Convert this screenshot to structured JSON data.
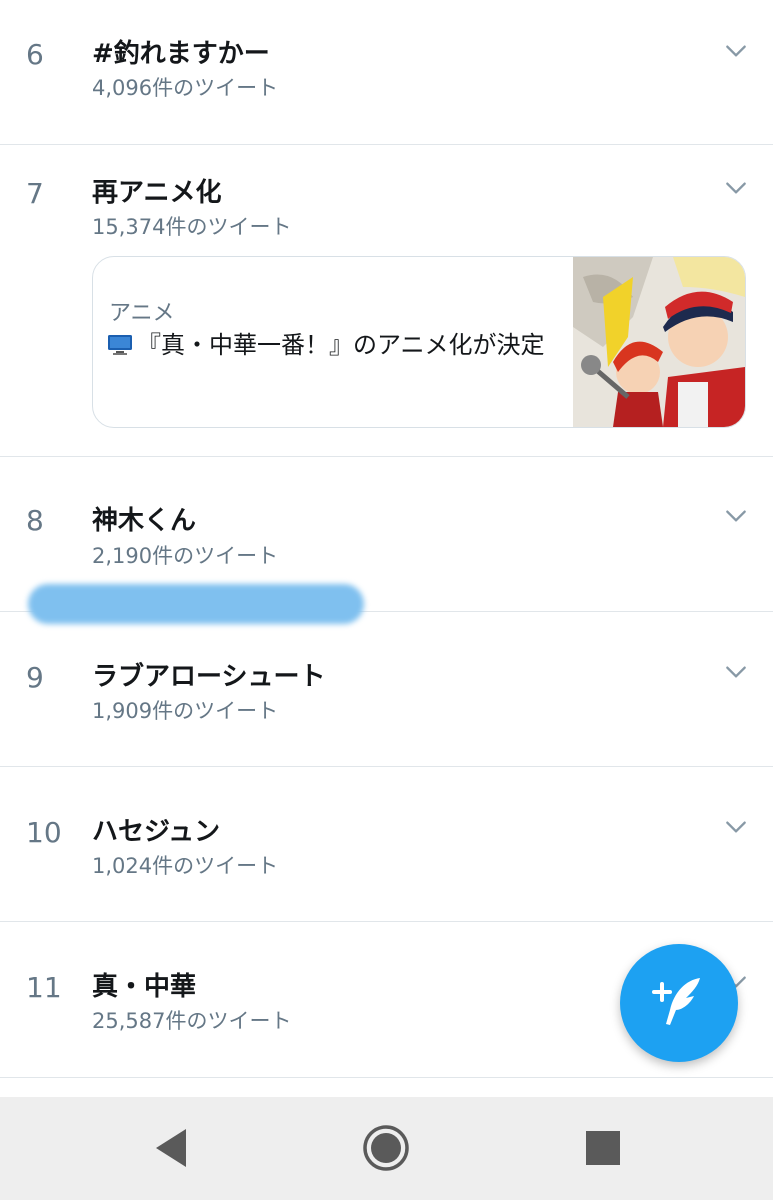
{
  "trends": [
    {
      "rank": "6",
      "title": "#釣れますかー",
      "count": "4,096件のツイート"
    },
    {
      "rank": "7",
      "title": "再アニメ化",
      "count": "15,374件のツイート",
      "card": {
        "category": "アニメ",
        "text": "『真・中華一番！』のアニメ化が決定",
        "icon": "tv-icon"
      }
    },
    {
      "rank": "8",
      "title": "神木くん",
      "count": "2,190件のツイート"
    },
    {
      "rank": "9",
      "title": "ラブアローシュート",
      "count": "1,909件のツイート"
    },
    {
      "rank": "10",
      "title": "ハセジュン",
      "count": "1,024件のツイート"
    },
    {
      "rank": "11",
      "title": "真・中華",
      "count": "25,587件のツイート"
    }
  ],
  "fab": {
    "icon": "compose-tweet-icon"
  },
  "navbar": {
    "back_icon": "back-triangle-icon",
    "home_icon": "home-circle-icon",
    "recents_icon": "recents-square-icon"
  },
  "colors": {
    "accent": "#1da1f2",
    "secondary_text": "#657786",
    "divider": "#e1e6ea",
    "redaction": "#7fc0ef"
  }
}
